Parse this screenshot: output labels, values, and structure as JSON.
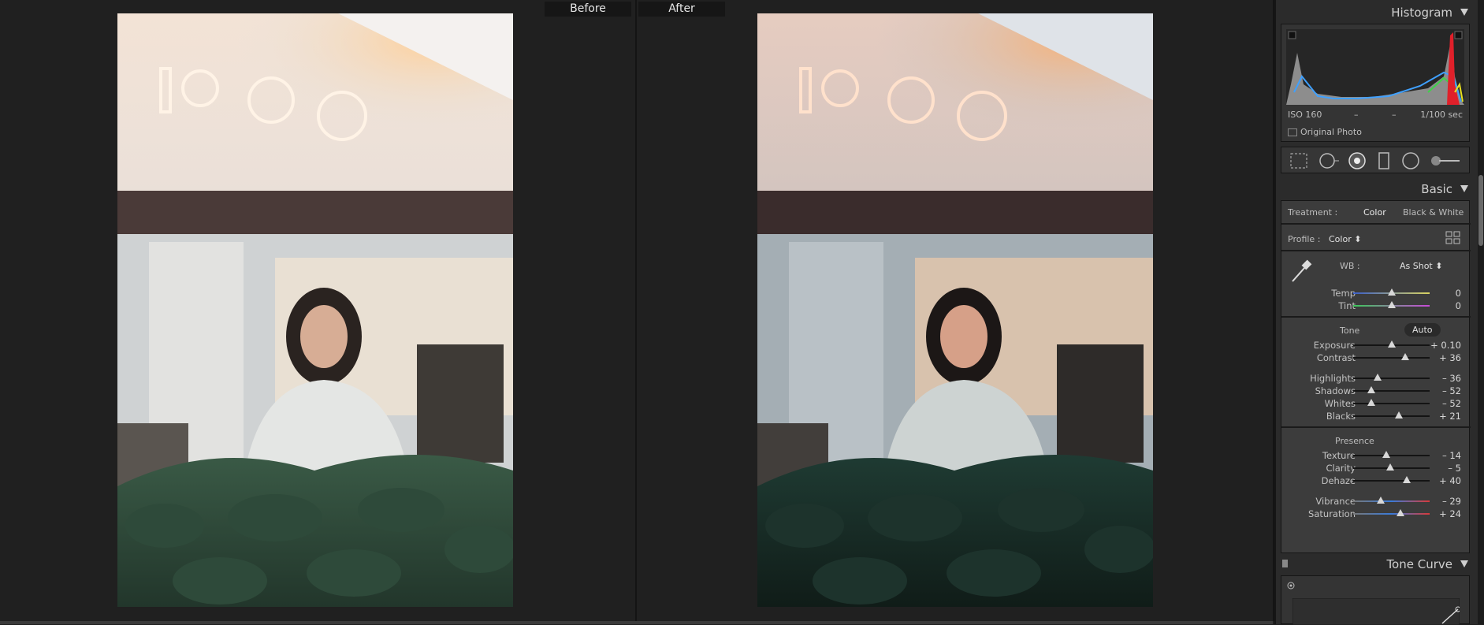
{
  "compare": {
    "before_label": "Before",
    "after_label": "After"
  },
  "histogram": {
    "title": "Histogram",
    "iso": "ISO 160",
    "focal": "–",
    "aperture": "–",
    "shutter": "1/100 sec",
    "original_photo_label": "Original Photo"
  },
  "basic": {
    "title": "Basic",
    "treatment_label": "Treatment :",
    "treatment_color": "Color",
    "treatment_bw": "Black & White",
    "profile_label": "Profile :",
    "profile_value": "Color ⬍",
    "wb_label": "WB :",
    "wb_value": "As Shot ⬍",
    "tone_label": "Tone",
    "auto_label": "Auto",
    "presence_label": "Presence",
    "sliders": {
      "temp": {
        "label": "Temp",
        "value": "0",
        "pos": 0.5
      },
      "tint": {
        "label": "Tint",
        "value": "0",
        "pos": 0.5
      },
      "exposure": {
        "label": "Exposure",
        "value": "+ 0.10",
        "pos": 0.51
      },
      "contrast": {
        "label": "Contrast",
        "value": "+ 36",
        "pos": 0.68
      },
      "highlights": {
        "label": "Highlights",
        "value": "– 36",
        "pos": 0.32
      },
      "shadows": {
        "label": "Shadows",
        "value": "– 52",
        "pos": 0.24
      },
      "whites": {
        "label": "Whites",
        "value": "– 52",
        "pos": 0.24
      },
      "blacks": {
        "label": "Blacks",
        "value": "+ 21",
        "pos": 0.6
      },
      "texture": {
        "label": "Texture",
        "value": "– 14",
        "pos": 0.43
      },
      "clarity": {
        "label": "Clarity",
        "value": "– 5",
        "pos": 0.48
      },
      "dehaze": {
        "label": "Dehaze",
        "value": "+ 40",
        "pos": 0.7
      },
      "vibrance": {
        "label": "Vibrance",
        "value": "– 29",
        "pos": 0.36
      },
      "saturation": {
        "label": "Saturation",
        "value": "+ 24",
        "pos": 0.62
      }
    }
  },
  "tone_curve": {
    "title": "Tone Curve"
  },
  "colors": {
    "panel_bg": "#2b2b2b",
    "box_bg": "#3c3c3c",
    "workspace_bg": "#202020"
  }
}
